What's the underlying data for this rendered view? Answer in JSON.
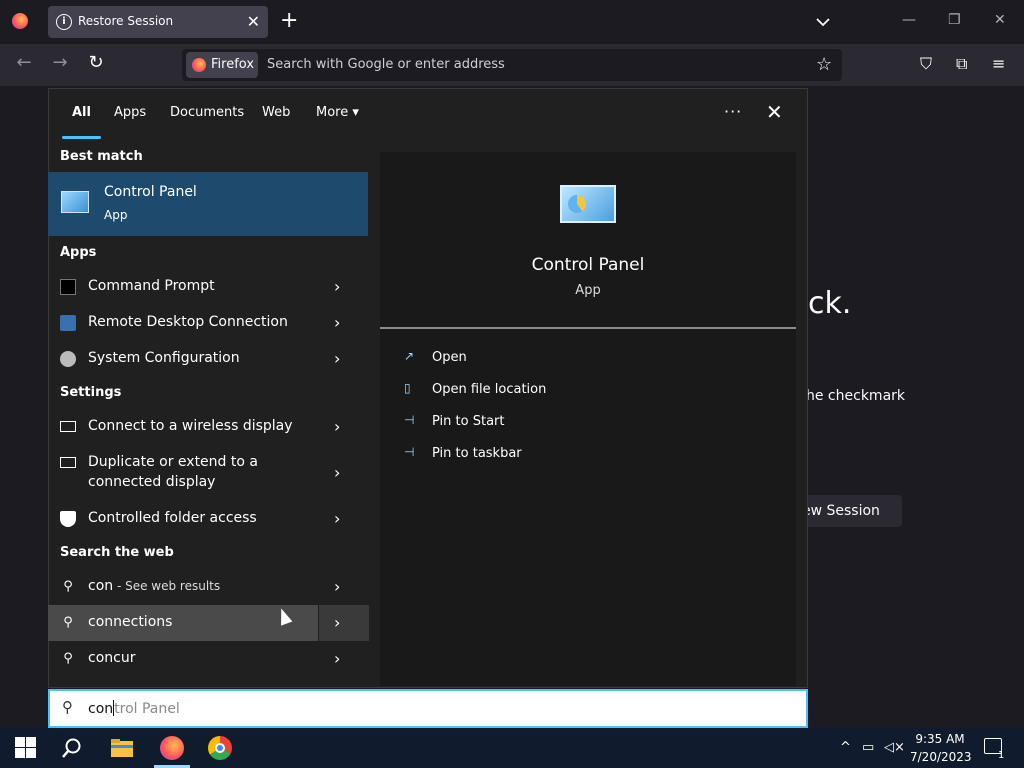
{
  "browser": {
    "tab_title": "Restore Session",
    "tab_info_icon": "i",
    "tab_close": "✕",
    "new_tab": "+",
    "tab_list": "⌄",
    "win_min": "—",
    "win_restore": "❐",
    "win_close": "✕",
    "back": "←",
    "forward": "→",
    "reload": "↻",
    "firefox_chip": "Firefox",
    "url_placeholder": "Search with Google or enter address",
    "star": "☆",
    "pocket": "⛉",
    "extensions": "⧉",
    "menu": "≡"
  },
  "background_page": {
    "title_fragment": "ck.",
    "text_fragment": "he checkmark",
    "button_fragment": "ew Session"
  },
  "search": {
    "tabs": [
      "All",
      "Apps",
      "Documents",
      "Web",
      "More ▾"
    ],
    "more_dots": "···",
    "close": "✕",
    "best_match_header": "Best match",
    "best_match": {
      "title": "Control Panel",
      "subtitle": "App"
    },
    "apps_header": "Apps",
    "apps": [
      {
        "label": "Command Prompt"
      },
      {
        "label": "Remote Desktop Connection"
      },
      {
        "label": "System Configuration"
      }
    ],
    "settings_header": "Settings",
    "settings": [
      {
        "label": "Connect to a wireless display"
      },
      {
        "label_line1": "Duplicate or extend to a",
        "label_line2": "connected display"
      },
      {
        "label": "Controlled folder access"
      }
    ],
    "web_header": "Search the web",
    "web": [
      {
        "label": "con",
        "suffix": " - See web results"
      },
      {
        "label": "connections"
      },
      {
        "label": "concur"
      }
    ],
    "chevron": "›",
    "preview": {
      "title": "Control Panel",
      "subtitle": "App",
      "actions": [
        {
          "label": "Open",
          "icon": "↗"
        },
        {
          "label": "Open file location",
          "icon": "▯"
        },
        {
          "label": "Pin to Start",
          "icon": "⊣"
        },
        {
          "label": "Pin to taskbar",
          "icon": "⊣"
        }
      ]
    },
    "query_typed": "con",
    "query_hint": "trol Panel",
    "search_icon": "⚲"
  },
  "taskbar": {
    "time": "9:35 AM",
    "date": "7/20/2023",
    "tray_chevron": "^",
    "notification_count": "1"
  }
}
